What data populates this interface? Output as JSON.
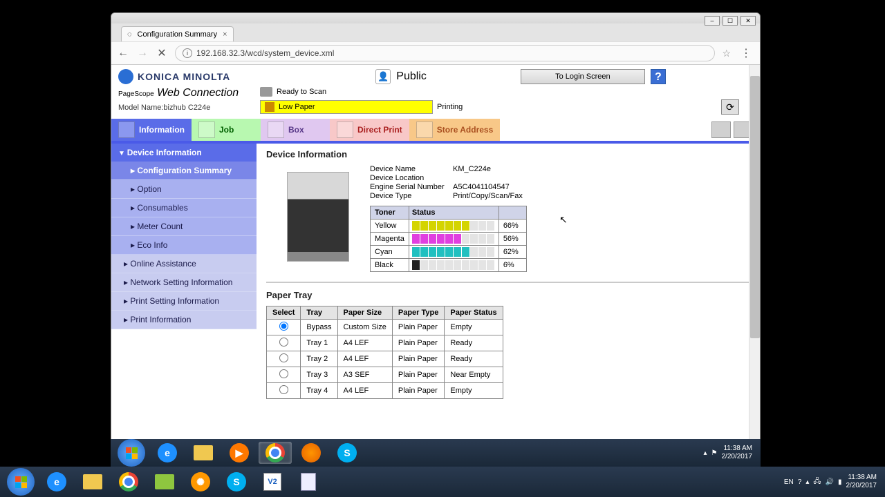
{
  "browser": {
    "tab_title": "Configuration Summary",
    "url": "192.168.32.3/wcd/system_device.xml"
  },
  "brand": {
    "name": "KONICA MINOLTA",
    "pagescope": "PageScope",
    "webconnection": "Web Connection",
    "model_label": "Model Name:",
    "model_value": "bizhub C224e"
  },
  "top": {
    "user": "Public",
    "login_btn": "To Login Screen",
    "help": "?",
    "status1": "Ready to Scan",
    "warning": "Low Paper",
    "status2": "Printing"
  },
  "tabs": {
    "information": "Information",
    "job": "Job",
    "box": "Box",
    "direct_print": "Direct Print",
    "store_address": "Store Address"
  },
  "sidebar": {
    "device_information": "Device Information",
    "items": [
      "Configuration Summary",
      "Option",
      "Consumables",
      "Meter Count",
      "Eco Info"
    ],
    "top_items": [
      "Online Assistance",
      "Network Setting Information",
      "Print Setting Information",
      "Print Information"
    ]
  },
  "device_info": {
    "title": "Device Information",
    "rows": [
      {
        "label": "Device Name",
        "value": "KM_C224e"
      },
      {
        "label": "Device Location",
        "value": ""
      },
      {
        "label": "Engine Serial Number",
        "value": "A5C4041104547"
      },
      {
        "label": "Device Type",
        "value": "Print/Copy/Scan/Fax"
      }
    ],
    "toner_header": {
      "toner": "Toner",
      "status": "Status"
    },
    "toners": [
      {
        "name": "Yellow",
        "pct": "66%",
        "segs": 7,
        "cls": "fill-y"
      },
      {
        "name": "Magenta",
        "pct": "56%",
        "segs": 6,
        "cls": "fill-m"
      },
      {
        "name": "Cyan",
        "pct": "62%",
        "segs": 7,
        "cls": "fill-c"
      },
      {
        "name": "Black",
        "pct": "6%",
        "segs": 1,
        "cls": "fill-k"
      }
    ]
  },
  "paper_tray": {
    "title": "Paper Tray",
    "headers": [
      "Select",
      "Tray",
      "Paper Size",
      "Paper Type",
      "Paper Status"
    ],
    "rows": [
      {
        "selected": true,
        "tray": "Bypass",
        "size": "Custom Size",
        "type": "Plain Paper",
        "status": "Empty"
      },
      {
        "selected": false,
        "tray": "Tray 1",
        "size": "A4 LEF",
        "type": "Plain Paper",
        "status": "Ready"
      },
      {
        "selected": false,
        "tray": "Tray 2",
        "size": "A4 LEF",
        "type": "Plain Paper",
        "status": "Ready"
      },
      {
        "selected": false,
        "tray": "Tray 3",
        "size": "A3 SEF",
        "type": "Plain Paper",
        "status": "Near Empty"
      },
      {
        "selected": false,
        "tray": "Tray 4",
        "size": "A4 LEF",
        "type": "Plain Paper",
        "status": "Empty"
      }
    ]
  },
  "tray1": {
    "time": "11:38 AM",
    "date": "2/20/2017",
    "lang": "EN"
  },
  "tray2": {
    "time": "11:38 AM",
    "date": "2/20/2017",
    "lang": "EN"
  }
}
